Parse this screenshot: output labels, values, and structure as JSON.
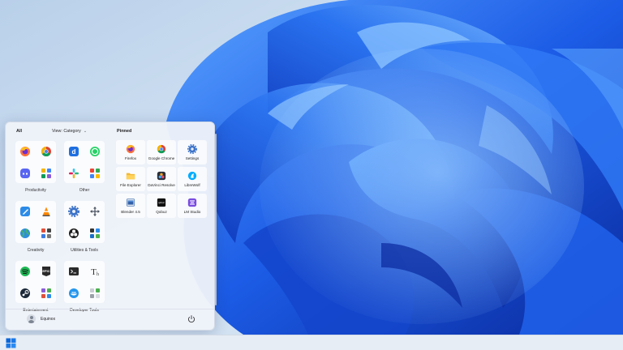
{
  "start_menu": {
    "all_label": "All",
    "view_label": "View: Category",
    "pinned_label": "Pinned",
    "groups": [
      {
        "label": "Productivity",
        "icons": [
          "firefox-icon",
          "chrome-icon",
          "discord-icon",
          "apps-folder-icon"
        ]
      },
      {
        "label": "Other",
        "icons": [
          "davinci-d-icon",
          "whatsapp-icon",
          "slack-icon",
          "apps-folder-icon"
        ]
      },
      {
        "label": "Creativity",
        "icons": [
          "pen-tool-icon",
          "vlc-icon",
          "globe-icon",
          "apps-folder-icon"
        ]
      },
      {
        "label": "Utilities & Tools",
        "icons": [
          "settings-gear-icon",
          "move-arrows-icon",
          "obs-icon",
          "apps-folder-icon"
        ]
      },
      {
        "label": "Entertainment",
        "icons": [
          "spotify-icon",
          "epic-games-icon",
          "steam-icon",
          "apps-folder-icon"
        ]
      },
      {
        "label": "Developer Tools",
        "icons": [
          "terminal-icon",
          "typography-icon",
          "docker-icon",
          "apps-folder-icon"
        ]
      }
    ],
    "pinned": [
      {
        "label": "Firefox",
        "icon": "firefox-icon"
      },
      {
        "label": "Google Chrome",
        "icon": "chrome-icon"
      },
      {
        "label": "Settings",
        "icon": "settings-gear-icon"
      },
      {
        "label": "File Explorer",
        "icon": "folder-icon"
      },
      {
        "label": "DaVinci Resolve",
        "icon": "davinci-resolve-icon"
      },
      {
        "label": "LibreWolf",
        "icon": "librewolf-icon"
      },
      {
        "label": "Blender 4.5",
        "icon": "blender-icon"
      },
      {
        "label": "Qobuz",
        "icon": "qobuz-icon"
      },
      {
        "label": "LM Studio",
        "icon": "lm-studio-icon"
      }
    ],
    "user_name": "Equinox"
  },
  "colors": {
    "accent": "#0a66d8",
    "wallpaper_sky": "#cfe0f2",
    "bloom_deep": "#0b2fb0",
    "bloom_light": "#3f8cff"
  }
}
